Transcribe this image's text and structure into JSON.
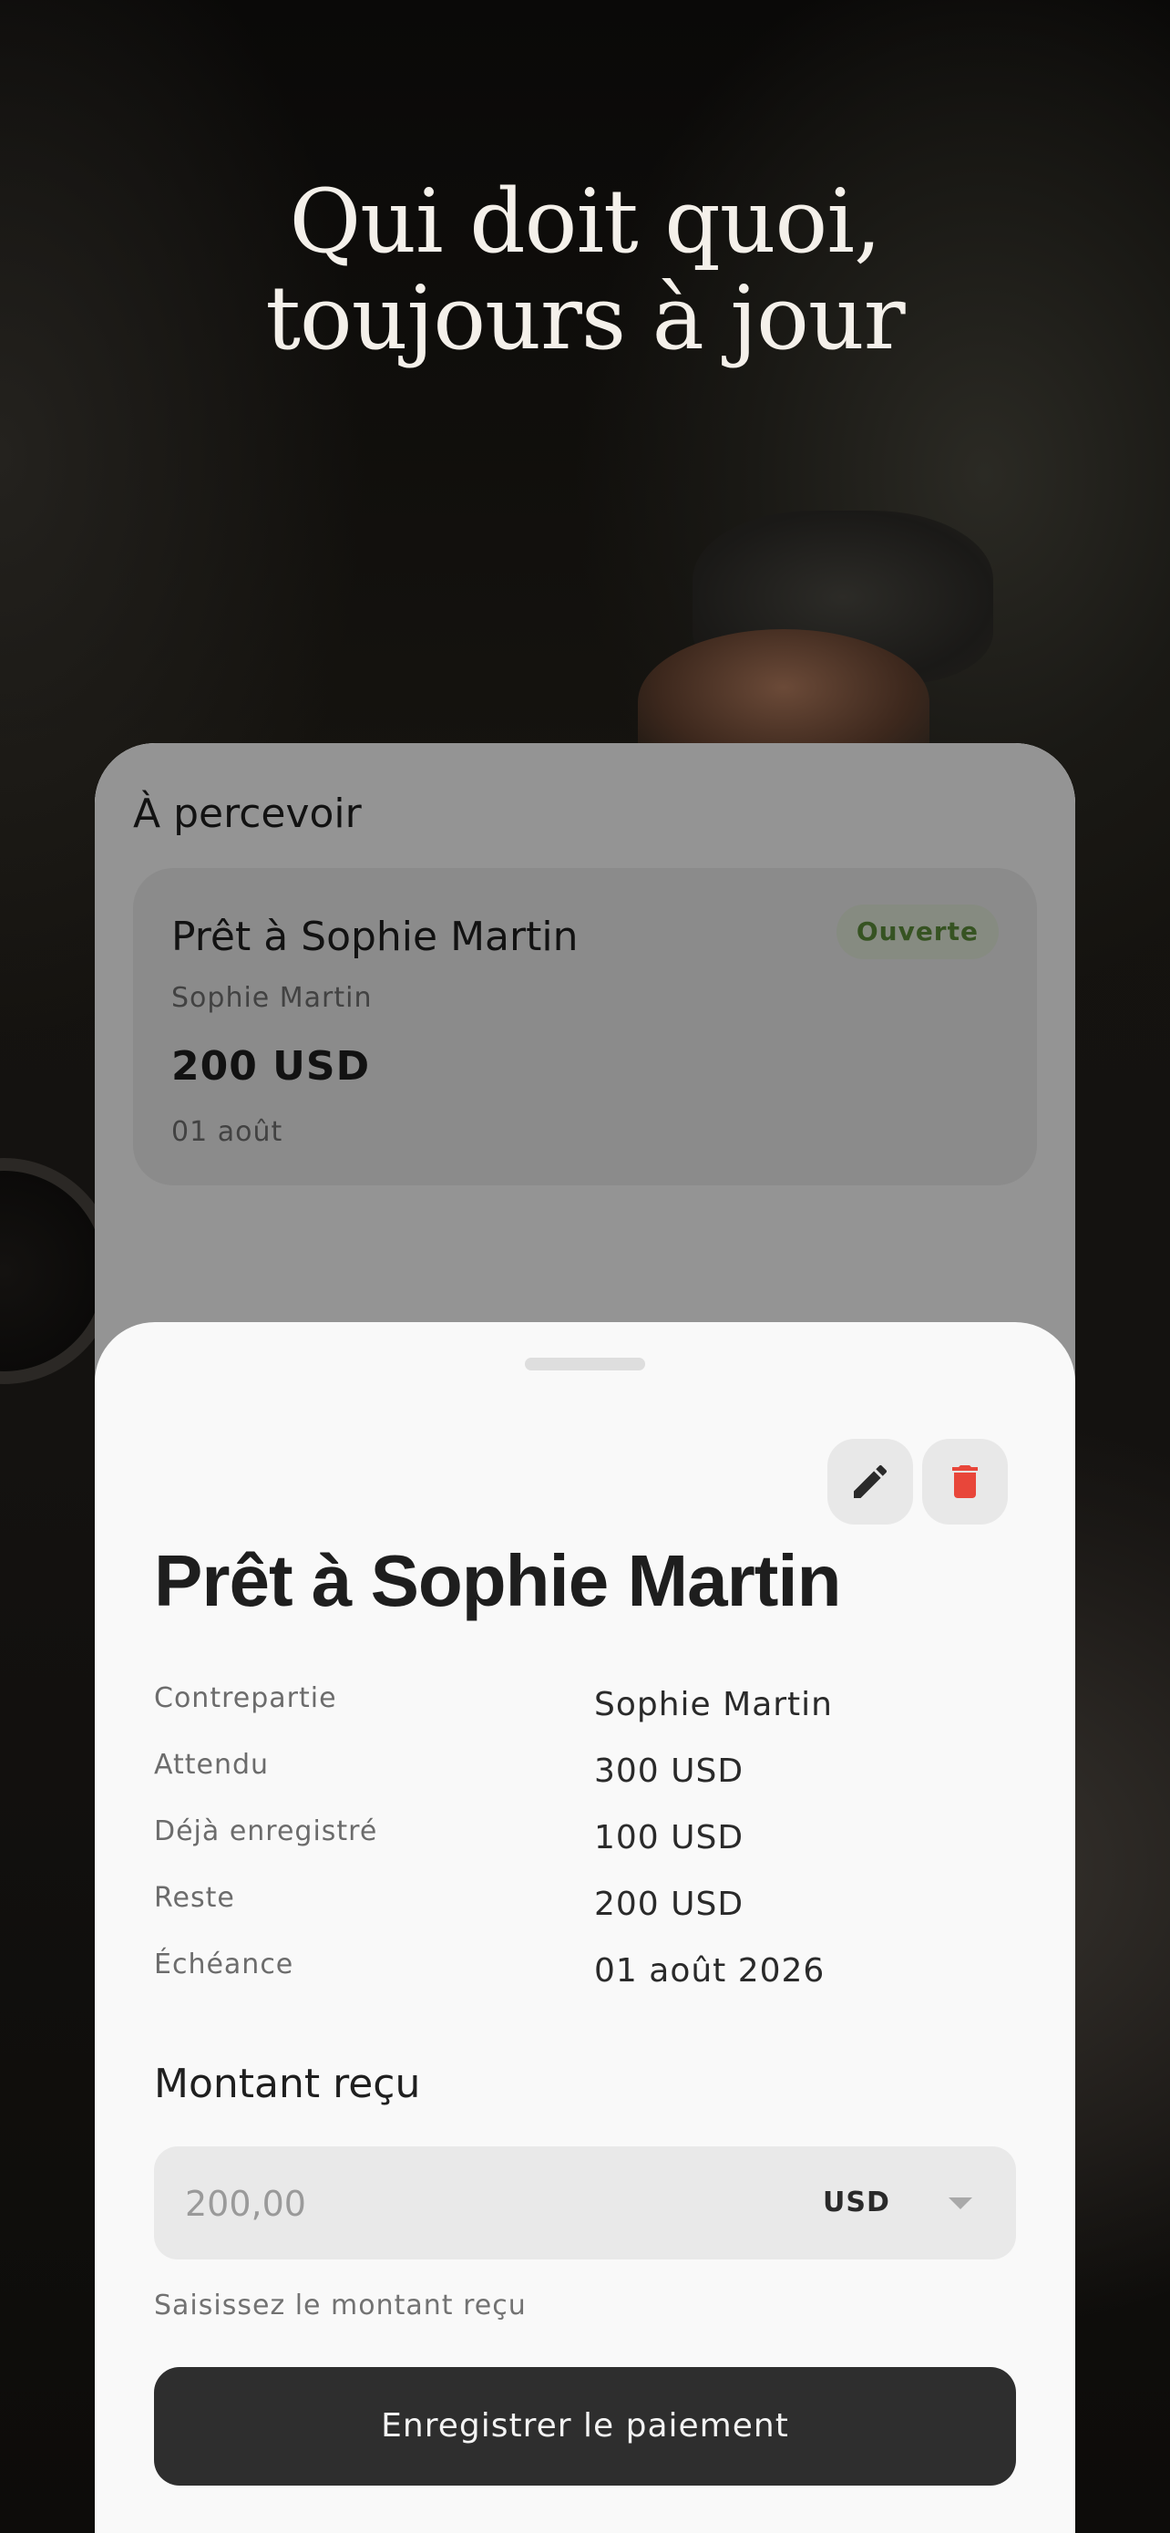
{
  "hero": {
    "line1": "Qui doit quoi,",
    "line2": "toujours à jour"
  },
  "list_screen": {
    "title": "À percevoir",
    "loan": {
      "title": "Prêt à Sophie Martin",
      "counterparty": "Sophie Martin",
      "amount": "200 USD",
      "due": "01 août",
      "status": "Ouverte"
    }
  },
  "detail_sheet": {
    "edit_icon": "pencil-icon",
    "delete_icon": "trash-icon",
    "title": "Prêt à Sophie Martin",
    "rows": [
      {
        "label": "Contrepartie",
        "value": "Sophie Martin"
      },
      {
        "label": "Attendu",
        "value": "300 USD"
      },
      {
        "label": "Déjà enregistré",
        "value": "100 USD"
      },
      {
        "label": "Reste",
        "value": "200 USD"
      },
      {
        "label": "Échéance",
        "value": "01 août 2026"
      }
    ],
    "amount_label": "Montant reçu",
    "amount_placeholder": "200,00",
    "currency": "USD",
    "helper": "Saisissez le montant reçu",
    "submit_label": "Enregistrer le paiement"
  },
  "colors": {
    "status_bg": "#dfe8d7",
    "status_text": "#5b8a3a",
    "delete_red": "#e8463a",
    "primary_button": "#2e2e2e"
  }
}
